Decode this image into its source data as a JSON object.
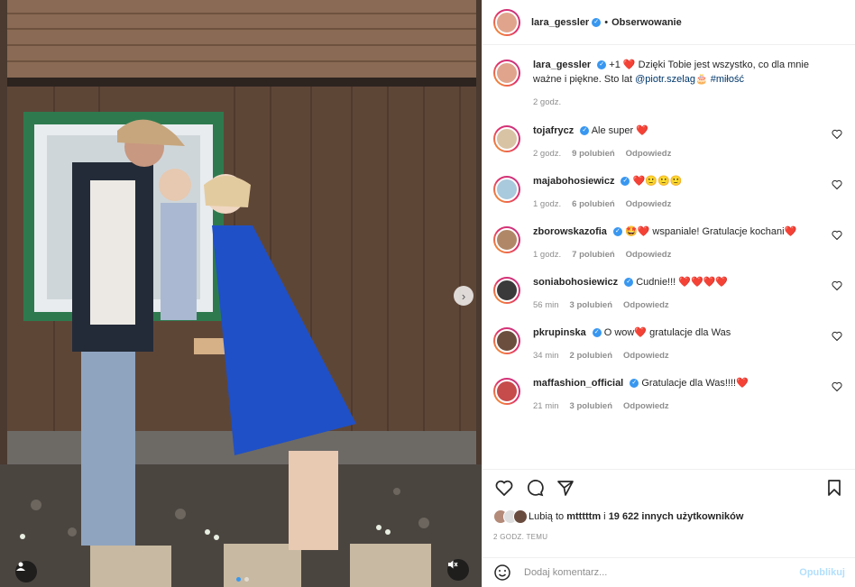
{
  "post": {
    "author": "lara_gessler",
    "follow_status": "Obserwowanie",
    "separator": "•",
    "caption_prefix": "+1 ",
    "caption_heart": "❤️",
    "caption_main": " Dzięki Tobie jest wszystko, co dla mnie ważne i piękne. Sto lat ",
    "caption_mention": "@piotr.szelag",
    "caption_emoji": "🎂",
    "caption_hashtag": "#miłość",
    "time": "2 godz."
  },
  "comments": [
    {
      "user": "tojafrycz",
      "verified": true,
      "text": "Ale super ❤️",
      "time": "2 godz.",
      "likes": "9 polubień",
      "reply": "Odpowiedz",
      "avatar_color": "#d8c3a5"
    },
    {
      "user": "majabohosiewicz",
      "verified": true,
      "text": "❤️🙂🙂🙂",
      "time": "1 godz.",
      "likes": "6 polubień",
      "reply": "Odpowiedz",
      "avatar_color": "#a9c9dc"
    },
    {
      "user": "zborowskazofia",
      "verified": true,
      "text": "🤩❤️ wspaniale! Gratulacje kochani❤️",
      "time": "1 godz.",
      "likes": "7 polubień",
      "reply": "Odpowiedz",
      "avatar_color": "#b08868"
    },
    {
      "user": "soniabohosiewicz",
      "verified": true,
      "text": "Cudnie!!! ❤️❤️❤️❤️",
      "time": "56 min",
      "likes": "3 polubień",
      "reply": "Odpowiedz",
      "avatar_color": "#3a3a3a"
    },
    {
      "user": "pkrupinska",
      "verified": true,
      "text": "O wow❤️ gratulacje dla Was",
      "time": "34 min",
      "likes": "2 polubień",
      "reply": "Odpowiedz",
      "avatar_color": "#6b4e3d"
    },
    {
      "user": "maffashion_official",
      "verified": true,
      "text": "Gratulacje dla Was!!!!❤️",
      "time": "21 min",
      "likes": "3 polubień",
      "reply": "Odpowiedz",
      "avatar_color": "#c64b4b"
    }
  ],
  "likes": {
    "prefix": "Lubią to",
    "user": "mtttttm",
    "middle": "i",
    "others": "19 622 innych użytkowników"
  },
  "time_full": "2 GODZ. TEMU",
  "add_comment": {
    "placeholder": "Dodaj komentarz...",
    "post_label": "Opublikuj"
  },
  "colors": {
    "link": "#00376b",
    "verified": "#3897f0",
    "muted": "#8e8e8e",
    "post_button": "#b2dffc",
    "heart": "#ed1c24"
  }
}
